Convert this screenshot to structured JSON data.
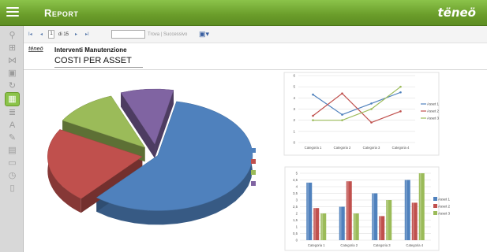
{
  "app": {
    "title": "Report",
    "logo": "tëneö"
  },
  "toolbar": {
    "first": "I◂",
    "prev": "◂",
    "page_value": "1",
    "of_pages": "di 15",
    "next": "▸",
    "last": "▸I",
    "find_links": "Trova | Successivo",
    "export_icon": "save-icon"
  },
  "report": {
    "logo": "tëneö",
    "title": "Interventi Manutenzione",
    "subtitle": "COSTI PER ASSET"
  },
  "sidebar_icons": [
    "search-icon",
    "sitemap-icon",
    "share-icon",
    "box-icon",
    "refresh-icon",
    "calendar-icon",
    "list-icon",
    "font-icon",
    "tools-icon",
    "chart-icon",
    "document-icon",
    "clock-icon",
    "page-icon"
  ],
  "colors": {
    "blue": "#4f81bd",
    "red": "#c0504d",
    "green": "#9bbb59",
    "purple": "#8064a2",
    "accent": "#6a9c2a"
  },
  "chart_data": [
    {
      "type": "pie",
      "values": [
        58,
        22,
        11,
        9
      ],
      "colors": [
        "#4f81bd",
        "#c0504d",
        "#9bbb59",
        "#8064a2"
      ],
      "legend": [
        "",
        "",
        "",
        ""
      ]
    },
    {
      "type": "line",
      "categories": [
        "Categoria 1",
        "Categoria 2",
        "Categoria 3",
        "Categoria 4"
      ],
      "ylim": [
        0,
        6
      ],
      "yticks": [
        "0",
        "1",
        "2",
        "3",
        "4",
        "5",
        "6"
      ],
      "series": [
        {
          "name": "Asset 1",
          "values": [
            4.3,
            2.5,
            3.5,
            4.5
          ],
          "color": "#4f81bd"
        },
        {
          "name": "Asset 2",
          "values": [
            2.4,
            4.4,
            1.8,
            2.8
          ],
          "color": "#c0504d"
        },
        {
          "name": "Asset 3",
          "values": [
            2.0,
            2.0,
            3.0,
            5.0
          ],
          "color": "#9bbb59"
        }
      ]
    },
    {
      "type": "bar",
      "categories": [
        "Categoria 1",
        "Categoria 2",
        "Categoria 3",
        "Categoria 4"
      ],
      "ylim": [
        0,
        5
      ],
      "yticks": [
        "0",
        "0,5",
        "1",
        "1,5",
        "2",
        "2,5",
        "3",
        "3,5",
        "4",
        "4,5",
        "5"
      ],
      "series": [
        {
          "name": "Asset 1",
          "values": [
            4.3,
            2.5,
            3.5,
            4.5
          ],
          "color": "#4f81bd"
        },
        {
          "name": "Asset 2",
          "values": [
            2.4,
            4.4,
            1.8,
            2.8
          ],
          "color": "#c0504d"
        },
        {
          "name": "Asset 3",
          "values": [
            2.0,
            2.0,
            3.0,
            5.0
          ],
          "color": "#9bbb59"
        }
      ]
    }
  ]
}
